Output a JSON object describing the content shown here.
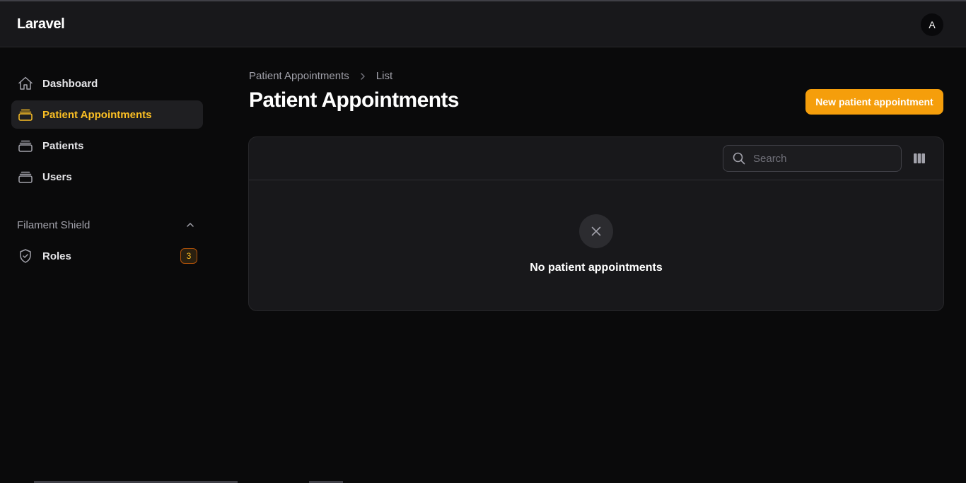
{
  "app": {
    "brand": "Laravel",
    "avatar_initial": "A"
  },
  "sidebar": {
    "items": [
      {
        "label": "Dashboard",
        "icon": "home-icon",
        "active": false
      },
      {
        "label": "Patient Appointments",
        "icon": "rectangle-stack-icon",
        "active": true
      },
      {
        "label": "Patients",
        "icon": "rectangle-stack-icon",
        "active": false
      },
      {
        "label": "Users",
        "icon": "rectangle-stack-icon",
        "active": false
      }
    ],
    "group": {
      "label": "Filament Shield",
      "items": [
        {
          "label": "Roles",
          "icon": "shield-check-icon",
          "badge": "3"
        }
      ]
    }
  },
  "breadcrumb": {
    "parent": "Patient Appointments",
    "current": "List"
  },
  "page": {
    "title": "Patient Appointments",
    "create_button": "New patient appointment"
  },
  "table": {
    "search_placeholder": "Search",
    "empty_heading": "No patient appointments"
  },
  "colors": {
    "accent": "#f59e0b",
    "active_text": "#fbbf24",
    "background": "#0a0a0b",
    "surface": "#18181b"
  }
}
